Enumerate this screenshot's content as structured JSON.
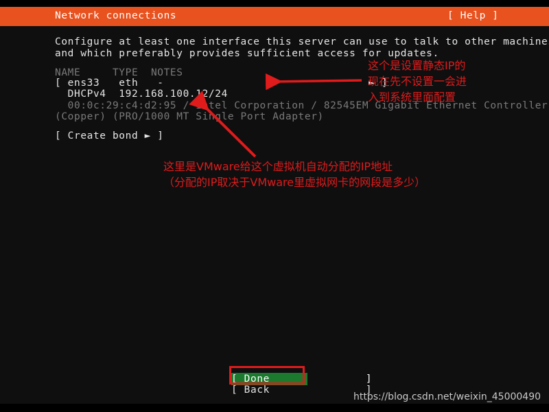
{
  "header": {
    "title": "Network connections",
    "help_label": "[ Help ]"
  },
  "description": {
    "line1": "Configure at least one interface this server can use to talk to other machines,",
    "line2": "and which preferably provides sufficient access for updates."
  },
  "table": {
    "headers": "NAME     TYPE  NOTES",
    "rows": [
      {
        "selector": "[ ens33   eth   -                                ► ]",
        "dhcp": "  DHCPv4  192.168.100.12/24",
        "detail_line1": "  00:0c:29:c4:d2:95 / Intel Corporation / 82545EM Gigabit Ethernet Controller",
        "detail_line2": "(Copper) (PRO/1000 MT Single Port Adapter)"
      }
    ]
  },
  "create_bond": {
    "label": "[ Create bond ► ]"
  },
  "footer": {
    "done_label": "[ Done               ]",
    "back_label": "[ Back               ]"
  },
  "annotations": {
    "static_ip_note": {
      "line1": "这个是设置静态IP的",
      "line2": "现在先不设置一会进",
      "line3": "入到系统里面配置"
    },
    "dhcp_note": {
      "line1": "这里是VMware给这个虚拟机自动分配的IP地址",
      "line2": "（分配的IP取决于VMware里虚拟网卡的网段是多少）"
    }
  },
  "watermark": {
    "text": "https://blog.csdn.net/weixin_45000490"
  },
  "colors": {
    "header_orange": "#e8521f",
    "annotation_red": "#e01b1b",
    "selected_green": "#1b7a2e",
    "background": "#0f0f10"
  }
}
